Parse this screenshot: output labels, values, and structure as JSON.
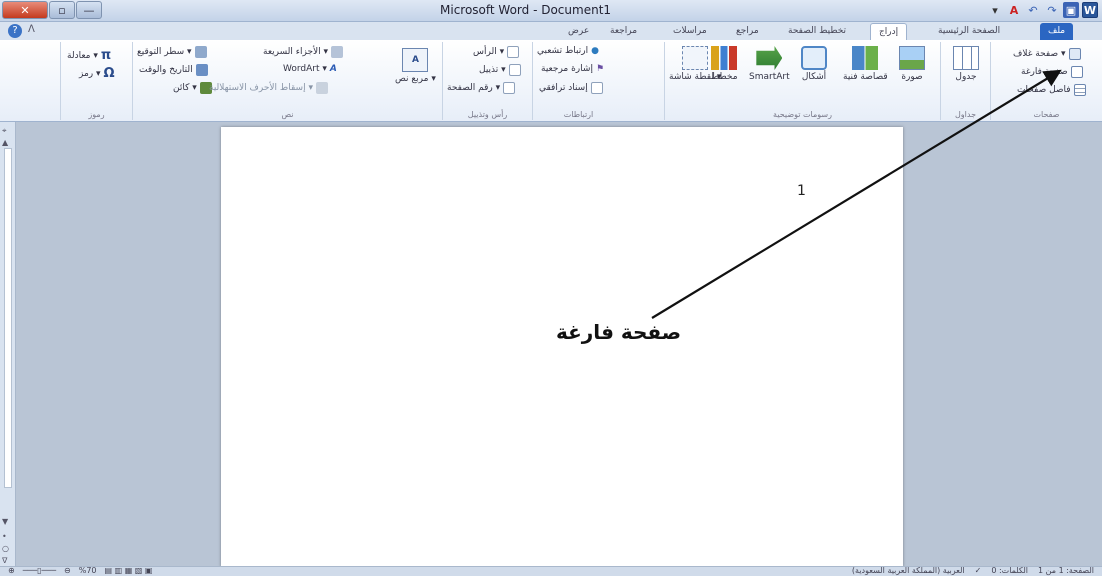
{
  "window": {
    "title": "Microsoft Word - Document1",
    "close_label": "✕",
    "restore_label": "▫",
    "minimize_label": "—"
  },
  "quick_access": {
    "word_logo": "W"
  },
  "tabs": [
    {
      "label": "ملف",
      "id": "file"
    },
    {
      "label": "الصفحة الرئيسية",
      "id": "home"
    },
    {
      "label": "إدراج",
      "id": "insert"
    },
    {
      "label": "تخطيط الصفحة",
      "id": "layout"
    },
    {
      "label": "مراجع",
      "id": "references"
    },
    {
      "label": "مراسلات",
      "id": "mailings"
    },
    {
      "label": "مراجعة",
      "id": "review"
    },
    {
      "label": "عرض",
      "id": "view"
    }
  ],
  "ribbon": {
    "pages": {
      "label": "صفحات",
      "cover": "صفحة غلاف ▾",
      "blank": "صفحة فارغة",
      "break": "فاصل صفحات"
    },
    "tables": {
      "label": "جداول",
      "table": "جدول"
    },
    "illustrations": {
      "label": "رسومات توضيحية",
      "picture": "صورة",
      "clipart": "قصاصة فنية",
      "shapes": "أشكال",
      "smartart": "SmartArt",
      "chart": "مخطط",
      "screenshot": "لقطة شاشة ▾"
    },
    "links": {
      "label": "ارتباطات",
      "hyperlink": "ارتباط تشعبي",
      "bookmark": "إشارة مرجعية",
      "crossref": "إسناد ترافقي"
    },
    "header_footer": {
      "label": "رأس وتذييل",
      "header": "الرأس ▾",
      "footer": "تذييل ▾",
      "page_number": "رقم الصفحة ▾"
    },
    "text": {
      "label": "نص",
      "textbox": "مربع نص ▾",
      "quickparts": "الأجزاء السريعة ▾",
      "wordart": "WordArt ▾",
      "dropcap": "إسقاط الأحرف الاستهلالية ▾",
      "signature": "سطر التوقيع ▾",
      "datetime": "التاريخ والوقت",
      "object": "كائن ▾"
    },
    "symbols": {
      "label": "رموز",
      "equation": "معادلة ▾",
      "symbol": "رمز ▾"
    }
  },
  "annotation": {
    "number": "1",
    "label": "صفحة فارغة"
  },
  "status": {
    "page": "الصفحة: 1 من 1",
    "words": "الكلمات: 0",
    "language": "العربية (المملكة العربية السعودية)",
    "zoom": "%70"
  }
}
